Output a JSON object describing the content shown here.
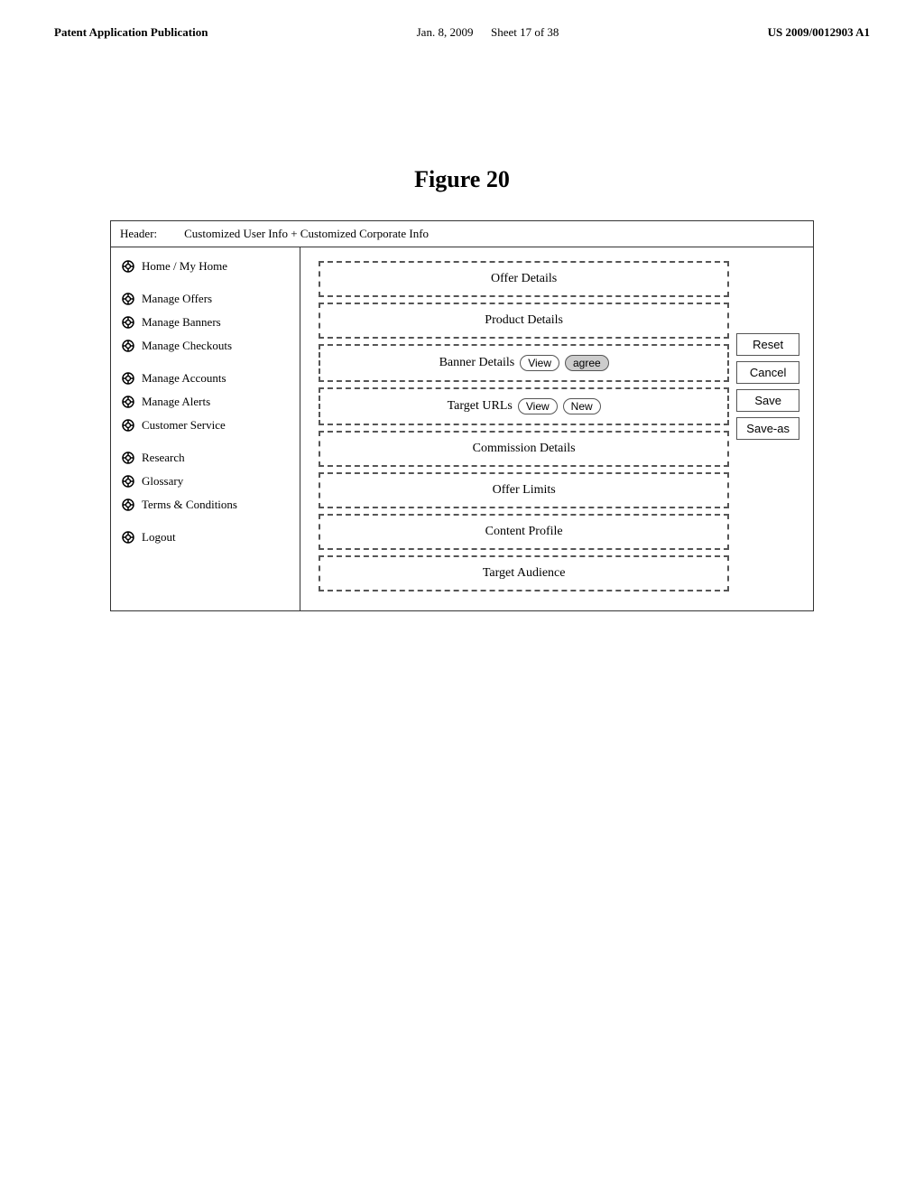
{
  "patent_header": {
    "left": "Patent Application Publication",
    "center": "Jan. 8, 2009",
    "sheet": "Sheet 17 of 38",
    "right": "US 2009/0012903 A1"
  },
  "figure": {
    "title": "Figure 20"
  },
  "diagram": {
    "header": {
      "label": "Header:",
      "value": "Customized User Info + Customized Corporate Info"
    },
    "sidebar": {
      "items": [
        {
          "id": "home",
          "label": "Home / My Home",
          "icon": "gear"
        },
        {
          "id": "manage-offers",
          "label": "Manage Offers",
          "icon": "gear"
        },
        {
          "id": "manage-banners",
          "label": "Manage Banners",
          "icon": "gear"
        },
        {
          "id": "manage-checkouts",
          "label": "Manage Checkouts",
          "icon": "gear"
        },
        {
          "id": "manage-accounts",
          "label": "Manage Accounts",
          "icon": "gear"
        },
        {
          "id": "manage-alerts",
          "label": "Manage Alerts",
          "icon": "gear"
        },
        {
          "id": "customer-service",
          "label": "Customer Service",
          "icon": "gear"
        },
        {
          "id": "research",
          "label": "Research",
          "icon": "gear"
        },
        {
          "id": "glossary",
          "label": "Glossary",
          "icon": "gear"
        },
        {
          "id": "terms",
          "label": "Terms & Conditions",
          "icon": "gear"
        },
        {
          "id": "logout",
          "label": "Logout",
          "icon": "gear"
        }
      ]
    },
    "sections": [
      {
        "id": "offer-details",
        "label": "Offer Details",
        "type": "normal"
      },
      {
        "id": "product-details",
        "label": "Product Details",
        "type": "normal"
      },
      {
        "id": "banner-details",
        "label": "Banner Details",
        "type": "with-buttons",
        "buttons": [
          "View",
          "agree"
        ]
      },
      {
        "id": "target-urls",
        "label": "Target URLs",
        "type": "with-buttons",
        "buttons": [
          "View",
          "New"
        ]
      },
      {
        "id": "commission-details",
        "label": "Commission Details",
        "type": "normal"
      },
      {
        "id": "offer-limits",
        "label": "Offer Limits",
        "type": "normal"
      },
      {
        "id": "content-profile",
        "label": "Content Profile",
        "type": "normal"
      },
      {
        "id": "target-audience",
        "label": "Target Audience",
        "type": "normal"
      }
    ],
    "action_buttons": [
      {
        "id": "reset-btn",
        "label": "Reset"
      },
      {
        "id": "cancel-btn",
        "label": "Cancel"
      },
      {
        "id": "save-btn",
        "label": "Save"
      },
      {
        "id": "save-as-btn",
        "label": "Save-as"
      }
    ]
  }
}
